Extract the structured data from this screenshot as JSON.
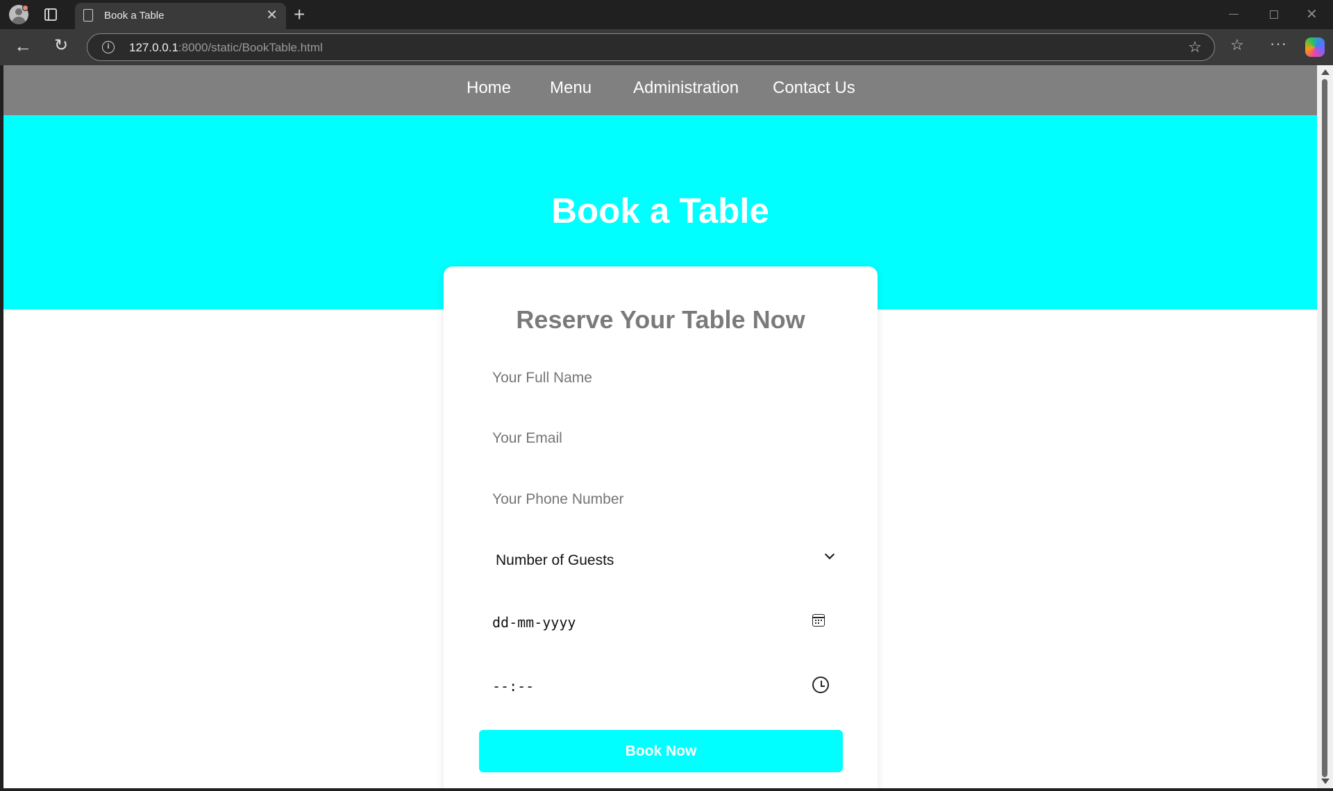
{
  "browser": {
    "tab_title": "Book a Table",
    "tab_close": "✕",
    "new_tab": "+",
    "url_host": "127.0.0.1",
    "url_rest": ":8000/static/BookTable.html",
    "icons": [
      "profile-icon",
      "tab-actions-icon",
      "page-icon",
      "back-arrow-icon",
      "reload-icon",
      "info-icon",
      "star-icon",
      "favorites-icon",
      "more-icon",
      "copilot-icon"
    ]
  },
  "nav": {
    "links": [
      {
        "label": "Home"
      },
      {
        "label": "Menu"
      },
      {
        "label": "Administration"
      },
      {
        "label": "Contact Us"
      }
    ]
  },
  "hero": {
    "title": "Book a Table",
    "background": "#00ffff"
  },
  "form": {
    "title": "Reserve Your Table Now",
    "name_placeholder": "Your Full Name",
    "email_placeholder": "Your Email",
    "phone_placeholder": "Your Phone Number",
    "guests_selected": "Number of Guests",
    "date_value": "dd-mm-yyyy",
    "time_value": "--:--",
    "submit_label": "Book Now"
  },
  "colors": {
    "nav_bg": "#808080",
    "accent": "#00ffff",
    "card_title": "#7a7a7a"
  }
}
